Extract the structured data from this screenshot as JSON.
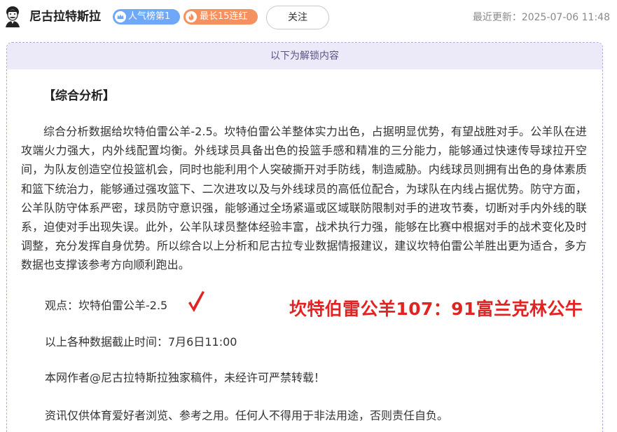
{
  "header": {
    "author_name": "尼古拉特斯拉",
    "badges": [
      {
        "label": "人气榜第1",
        "icon": "crown-icon",
        "color": "#6fa8f6"
      },
      {
        "label": "最长15连红",
        "icon": "flame-icon",
        "color": "#f5905f"
      }
    ],
    "follow_label": "关注",
    "update_label": "最近更新：",
    "update_time": "2025-07-06 11:48"
  },
  "content": {
    "unlock_banner": "以下为解锁内容",
    "section_title": "【综合分析】",
    "analysis": "综合分析数据给坎特伯雷公羊-2.5。坎特伯雷公羊整体实力出色，占据明显优势，有望战胜对手。公羊队在进攻端火力强大，内外线配置均衡。外线球员具备出色的投篮手感和精准的三分能力，能够通过快速传导球拉开空间，为队友创造空位投篮机会，同时也能利用个人突破撕开对手防线，制造威胁。内线球员则拥有出色的身体素质和篮下统治力，能够通过强攻篮下、二次进攻以及与外线球员的高低位配合，为球队在内线占据优势。防守方面，公羊队防守体系严密，球员防守意识强，能够通过全场紧逼或区域联防限制对手的进攻节奏，切断对手内外线的联系，迫使对手出现失误。此外，公羊队球员整体经验丰富，战术执行力强，能够在比赛中根据对手的战术变化及时调整，充分发挥自身优势。所以综合以上分析和尼古拉专业数据情报建议，建议坎特伯雷公羊胜出更为适合，多方数据也支撑该参考方向顺利跑出。",
    "viewpoint": "观点：坎特伯雷公羊-2.5",
    "result": "坎特伯雷公羊107：91富兰克林公牛",
    "deadline": "以上各种数据截止时间：7月6日11:00",
    "copyright": "本网作者@尼古拉特斯拉独家稿件，未经许可严禁转载！",
    "disclaimer": "资讯仅供体育爱好者浏览、参考之用。任何人不得用于非法用途，否则责任自负。"
  },
  "colors": {
    "accent_red": "#e02424",
    "unlock_bg": "#eceaf8",
    "card_border": "#b3a8dc"
  }
}
